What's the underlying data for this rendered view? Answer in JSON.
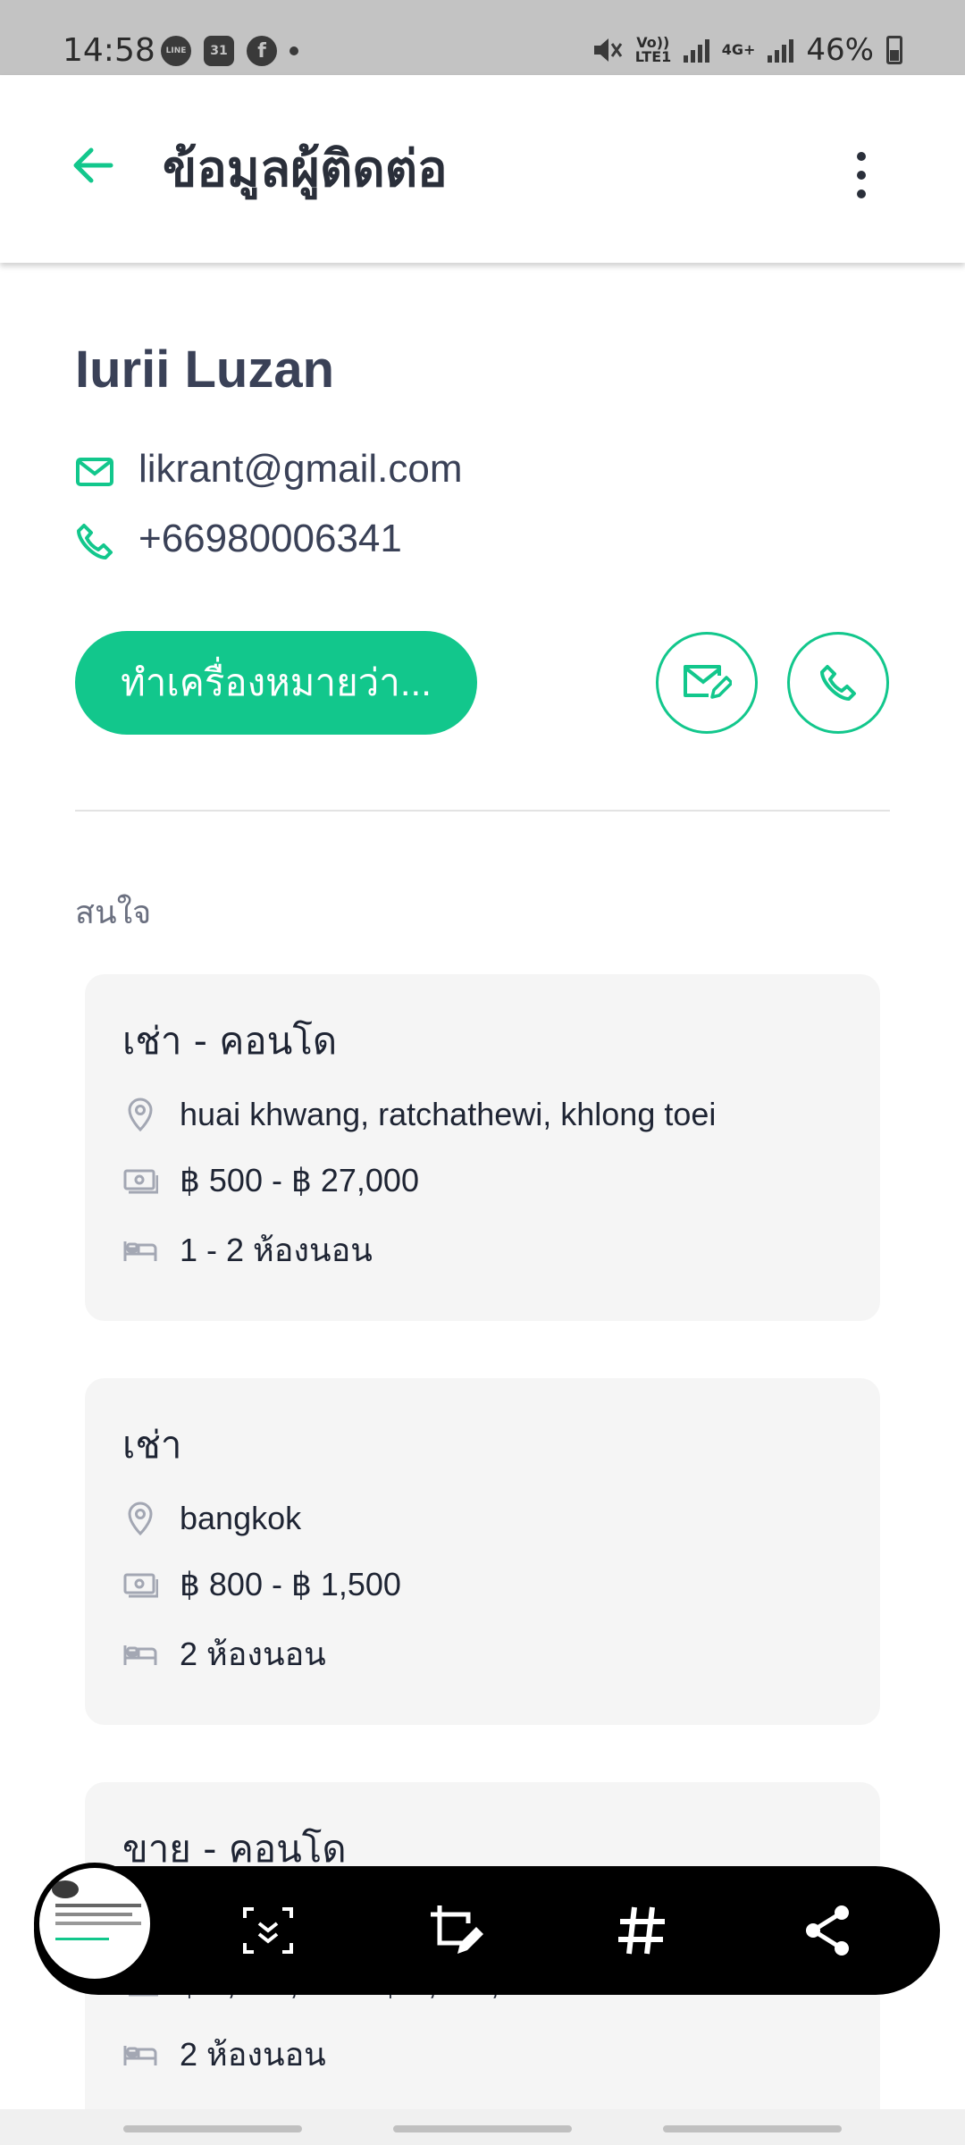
{
  "status_bar": {
    "time": "14:58",
    "battery": "46%",
    "network_label": "4G+",
    "volte_label": "Vo)) LTE1",
    "line_label": "LINE",
    "calendar_label": "31"
  },
  "app_bar": {
    "title": "ข้อมูลผู้ติดต่อ",
    "back_icon": "arrow-left-icon",
    "more_icon": "more-vertical-icon"
  },
  "contact": {
    "name": "Iurii Luzan",
    "email": "likrant@gmail.com",
    "phone": "+66980006341"
  },
  "actions": {
    "mark_as_label": "ทำเครื่องหมายว่า...",
    "email_icon": "email-edit-icon",
    "call_icon": "phone-icon"
  },
  "interests": {
    "section_label": "สนใจ",
    "cards": [
      {
        "title": "เช่า - คอนโด",
        "location": "huai khwang, ratchathewi, khlong toei",
        "price": "฿ 500 - ฿ 27,000",
        "bedrooms": "1 - 2 ห้องนอน"
      },
      {
        "title": "เช่า",
        "location": "bangkok",
        "price": "฿ 800 - ฿ 1,500",
        "bedrooms": "2 ห้องนอน"
      },
      {
        "title": "ขาย - คอนโด",
        "location": "",
        "price": "฿ 7,000,000 - ฿ 7,000,000",
        "bedrooms": "2 ห้องนอน"
      }
    ]
  },
  "colors": {
    "accent": "#12c78c",
    "text_dark": "#3a4157",
    "card_bg": "#f5f5f5",
    "status_bar_bg": "#c3c3c3"
  },
  "screenshot_toolbar": {
    "tools": [
      "scroll-capture-icon",
      "crop-edit-icon",
      "hashtag-icon",
      "share-icon"
    ]
  }
}
